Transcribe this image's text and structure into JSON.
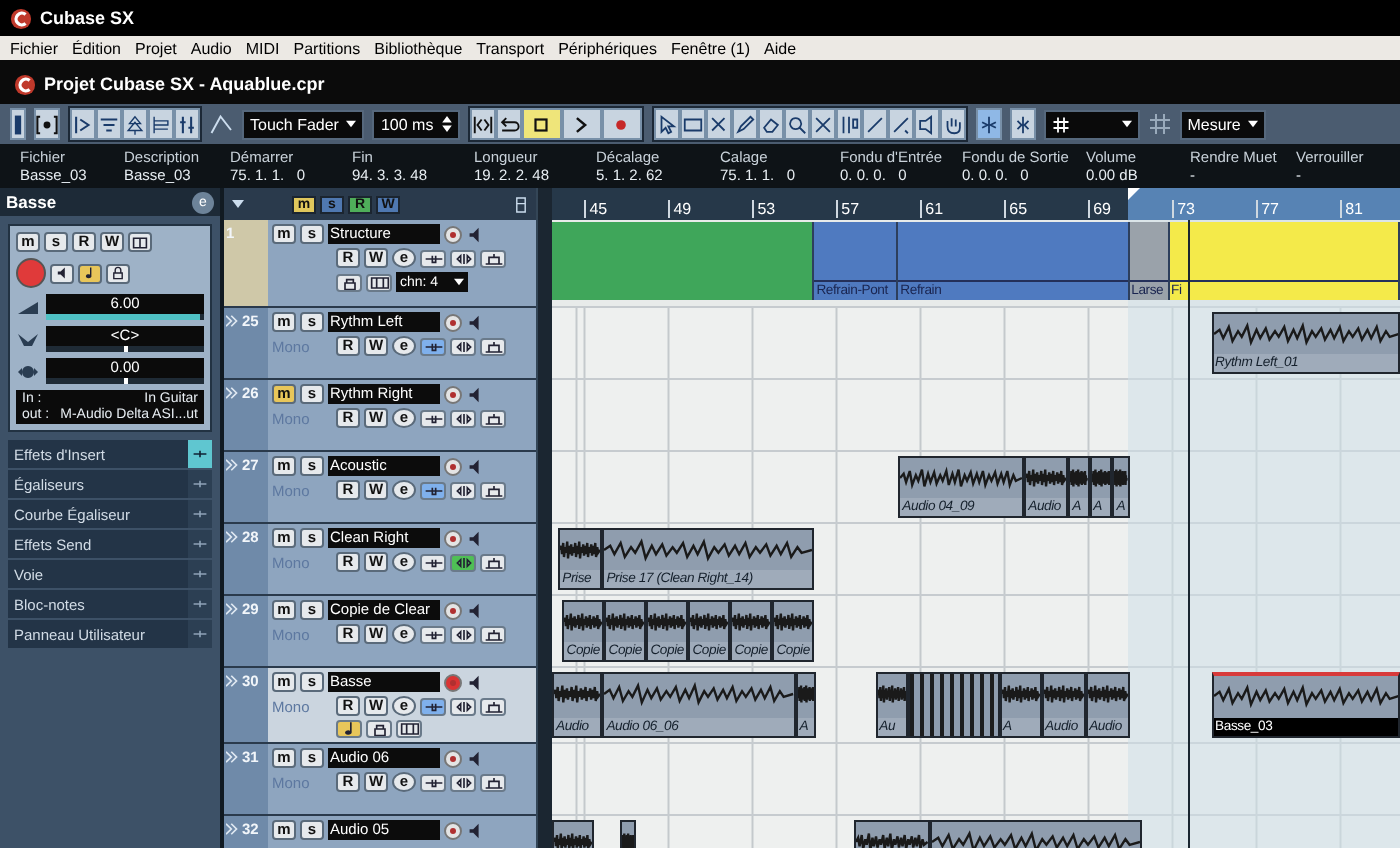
{
  "app": {
    "title": "Cubase SX"
  },
  "menu": [
    "Fichier",
    "Édition",
    "Projet",
    "Audio",
    "MIDI",
    "Partitions",
    "Bibliothèque",
    "Transport",
    "Périphériques",
    "Fenêtre (1)",
    "Aide"
  ],
  "project": {
    "title": "Projet Cubase SX - Aquablue.cpr"
  },
  "toolbar": {
    "automation_mode": "Touch Fader",
    "preroll": "100 ms",
    "stop_on": true,
    "snap_on": true,
    "grid_type": "Mesure"
  },
  "info_line": [
    {
      "label": "Fichier",
      "value": "Basse_03"
    },
    {
      "label": "Description",
      "value": "Basse_03"
    },
    {
      "label": "Démarrer",
      "value": "75. 1. 1.   0"
    },
    {
      "label": "Fin",
      "value": "94. 3. 3. 48"
    },
    {
      "label": "Longueur",
      "value": "19. 2. 2. 48"
    },
    {
      "label": "Décalage",
      "value": "5. 1. 2. 62"
    },
    {
      "label": "Calage",
      "value": "75. 1. 1.   0"
    },
    {
      "label": "Fondu d'Entrée",
      "value": "0. 0. 0.   0"
    },
    {
      "label": "Fondu de Sortie",
      "value": "0. 0. 0.   0"
    },
    {
      "label": "Volume",
      "value": "0.00 dB"
    },
    {
      "label": "Rendre Muet",
      "value": "-"
    },
    {
      "label": "Verrouiller",
      "value": "-"
    }
  ],
  "inspector": {
    "name": "Basse",
    "edit": "e",
    "buttons": [
      "m",
      "s",
      "R",
      "W"
    ],
    "record_on": true,
    "faders": [
      {
        "kind": "volume",
        "reading": "6.00",
        "level": 0.97
      },
      {
        "kind": "pan",
        "reading": "<C>",
        "level": 0.5
      },
      {
        "kind": "delay",
        "reading": "0.00",
        "level": 0.5
      }
    ],
    "input": {
      "label": "In :",
      "value": "In Guitar"
    },
    "output": {
      "label": "out :",
      "value": "M-Audio Delta ASI...ut"
    },
    "sections": [
      {
        "label": "Effets d'Insert",
        "active": true
      },
      {
        "label": "Égaliseurs",
        "active": false
      },
      {
        "label": "Courbe Égaliseur",
        "active": false
      },
      {
        "label": "Effets Send",
        "active": false
      },
      {
        "label": "Voie",
        "active": false
      },
      {
        "label": "Bloc-notes",
        "active": false
      },
      {
        "label": "Panneau Utilisateur",
        "active": false
      }
    ]
  },
  "track_list": {
    "toggles": [
      {
        "label": "m",
        "color": "#e0c75c"
      },
      {
        "label": "s",
        "color": "#4f78b0"
      },
      {
        "label": "R",
        "color": "#4fae5a"
      },
      {
        "label": "W",
        "color": "#4f78b0"
      }
    ]
  },
  "ruler": {
    "ticks": [
      "45",
      "49",
      "53",
      "57",
      "61",
      "65",
      "69",
      "73",
      "77",
      "81"
    ]
  },
  "tracks": [
    {
      "number": "1",
      "kind": "folder",
      "name": "Structure",
      "buttons": {
        "mute": "m",
        "solo": "s",
        "read": "R",
        "write": "W",
        "edit": "e"
      },
      "channel_select": "chn: 4",
      "selected": false,
      "mute_on": false,
      "record_on": false,
      "insert_on": false,
      "eq_on": false,
      "events": [
        {
          "kind": "part",
          "color": "#3fa65a"
        },
        {
          "kind": "part",
          "name": "Refrain-Pont",
          "color": "#4f7ac0"
        },
        {
          "kind": "part",
          "name": "Refrain",
          "color": "#4f7ac0"
        },
        {
          "kind": "part",
          "name": "Larse",
          "color": "#9aa2aa"
        },
        {
          "kind": "part",
          "name": "Fi",
          "color": "#f4ea4a"
        }
      ]
    },
    {
      "number": "25",
      "kind": "audio",
      "name": "Rythm Left",
      "channel": "Mono",
      "buttons": {
        "mute": "m",
        "solo": "s",
        "read": "R",
        "write": "W",
        "edit": "e"
      },
      "selected": false,
      "expanded": false,
      "mute_on": false,
      "record_on": false,
      "insert_on": true,
      "eq_on": false,
      "events": [
        {
          "kind": "audio",
          "name": "Rythm Left_01",
          "selected": false
        }
      ]
    },
    {
      "number": "26",
      "kind": "audio",
      "name": "Rythm Right",
      "channel": "Mono",
      "buttons": {
        "mute": "m",
        "solo": "s",
        "read": "R",
        "write": "W",
        "edit": "e"
      },
      "selected": false,
      "expanded": false,
      "mute_on": true,
      "record_on": false,
      "insert_on": false,
      "eq_on": false
    },
    {
      "number": "27",
      "kind": "audio",
      "name": "Acoustic",
      "channel": "Mono",
      "buttons": {
        "mute": "m",
        "solo": "s",
        "read": "R",
        "write": "W",
        "edit": "e"
      },
      "selected": false,
      "expanded": false,
      "mute_on": false,
      "record_on": false,
      "insert_on": true,
      "eq_on": false,
      "events": [
        {
          "kind": "audio",
          "name": "Audio 04_09",
          "selected": false
        },
        {
          "kind": "audio",
          "name": "Audio",
          "selected": false
        },
        {
          "kind": "audio",
          "name": "A",
          "selected": false
        },
        {
          "kind": "audio",
          "name": "A",
          "selected": false
        },
        {
          "kind": "audio",
          "name": "A",
          "selected": false
        }
      ]
    },
    {
      "number": "28",
      "kind": "audio",
      "name": "Clean Right",
      "channel": "Mono",
      "buttons": {
        "mute": "m",
        "solo": "s",
        "read": "R",
        "write": "W",
        "edit": "e"
      },
      "selected": false,
      "expanded": false,
      "mute_on": false,
      "record_on": false,
      "insert_on": false,
      "eq_on": true,
      "events": [
        {
          "kind": "audio",
          "name": "Prise",
          "selected": false
        },
        {
          "kind": "audio",
          "name": "Prise 17 (Clean Right_14)",
          "selected": false
        }
      ]
    },
    {
      "number": "29",
      "kind": "audio",
      "name": "Copie de Clear",
      "channel": "Mono",
      "buttons": {
        "mute": "m",
        "solo": "s",
        "read": "R",
        "write": "W",
        "edit": "e"
      },
      "selected": false,
      "expanded": false,
      "mute_on": false,
      "record_on": false,
      "insert_on": false,
      "eq_on": false,
      "events": [
        {
          "kind": "audio",
          "name": "Copie",
          "selected": false
        },
        {
          "kind": "audio",
          "name": "Copie",
          "selected": false
        },
        {
          "kind": "audio",
          "name": "Copie",
          "selected": false
        },
        {
          "kind": "audio",
          "name": "Copie",
          "selected": false
        },
        {
          "kind": "audio",
          "name": "Copie",
          "selected": false
        },
        {
          "kind": "audio",
          "name": "Copie",
          "selected": false
        }
      ]
    },
    {
      "number": "30",
      "kind": "audio",
      "name": "Basse",
      "channel": "Mono",
      "buttons": {
        "mute": "m",
        "solo": "s",
        "read": "R",
        "write": "W",
        "edit": "e"
      },
      "selected": true,
      "expanded": true,
      "mute_on": false,
      "record_on": true,
      "insert_on": true,
      "eq_on": false,
      "events": [
        {
          "kind": "audio",
          "name": "Audio",
          "selected": false
        },
        {
          "kind": "audio",
          "name": "Audio 06_06",
          "selected": false
        },
        {
          "kind": "audio",
          "name": "A",
          "selected": false
        },
        {
          "kind": "audio",
          "name": "Au",
          "selected": false
        },
        {
          "kind": "sliced",
          "selected": false
        },
        {
          "kind": "audio",
          "name": "A",
          "selected": false
        },
        {
          "kind": "audio",
          "name": "Audio",
          "selected": false
        },
        {
          "kind": "audio",
          "name": "Audio",
          "selected": false
        },
        {
          "kind": "audio",
          "name": "Basse_03",
          "selected": true
        }
      ]
    },
    {
      "number": "31",
      "kind": "audio",
      "name": "Audio 06",
      "channel": "Mono",
      "buttons": {
        "mute": "m",
        "solo": "s",
        "read": "R",
        "write": "W",
        "edit": "e"
      },
      "selected": false,
      "expanded": false,
      "mute_on": false,
      "record_on": false,
      "insert_on": false,
      "eq_on": false
    },
    {
      "number": "32",
      "kind": "audio",
      "name": "Audio 05",
      "buttons": {
        "mute": "m",
        "solo": "s"
      },
      "selected": false,
      "expanded": false,
      "mute_on": false,
      "record_on": false,
      "events": [
        {
          "kind": "audio",
          "selected": false
        },
        {
          "kind": "audio",
          "selected": false
        },
        {
          "kind": "audio",
          "selected": false
        },
        {
          "kind": "audio",
          "selected": false
        }
      ]
    }
  ]
}
